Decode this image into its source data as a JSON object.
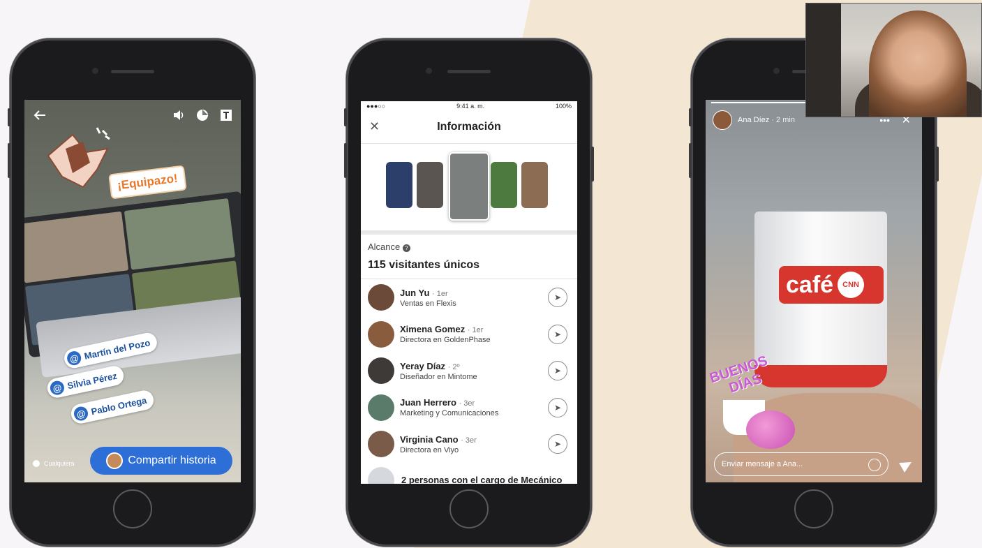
{
  "phone1": {
    "sticker_text": "¡Equipazo!",
    "mentions": [
      "Martín del Pozo",
      "Silvia Pérez",
      "Pablo Ortega"
    ],
    "audience": "Cualquiera",
    "share_button": "Compartir historia"
  },
  "phone2": {
    "status_time": "9:41 a. m.",
    "status_battery": "100%",
    "title": "Información",
    "reach_label": "Alcance",
    "reach_value": "115 visitantes únicos",
    "viewers": [
      {
        "name": "Jun Yu",
        "degree": "· 1er",
        "role": "Ventas en Flexis"
      },
      {
        "name": "Ximena Gomez",
        "degree": "· 1er",
        "role": "Directora en GoldenPhase"
      },
      {
        "name": "Yeray Díaz",
        "degree": "· 2º",
        "role": "Diseñador en Mintome"
      },
      {
        "name": "Juan Herrero",
        "degree": "· 3er",
        "role": "Marketing y Comunicaciones"
      },
      {
        "name": "Virginia Cano",
        "degree": "· 3er",
        "role": "Directora en Viyo"
      }
    ],
    "more_text": "2 personas con el cargo de Mecánico"
  },
  "phone3": {
    "author": "Ana Díez",
    "time": "· 2 min",
    "mug_text": "café",
    "mug_badge": "CNN",
    "sticker_line1": "BUENOS",
    "sticker_line2": "DÍAS",
    "message_placeholder": "Enviar mensaje a Ana..."
  },
  "colors": {
    "accent_blue": "#2d6fd6",
    "mention_blue": "#1a4f9c",
    "orange": "#e8782a",
    "mug_red": "#d7362e",
    "sticker_pink": "#c85ad6"
  }
}
